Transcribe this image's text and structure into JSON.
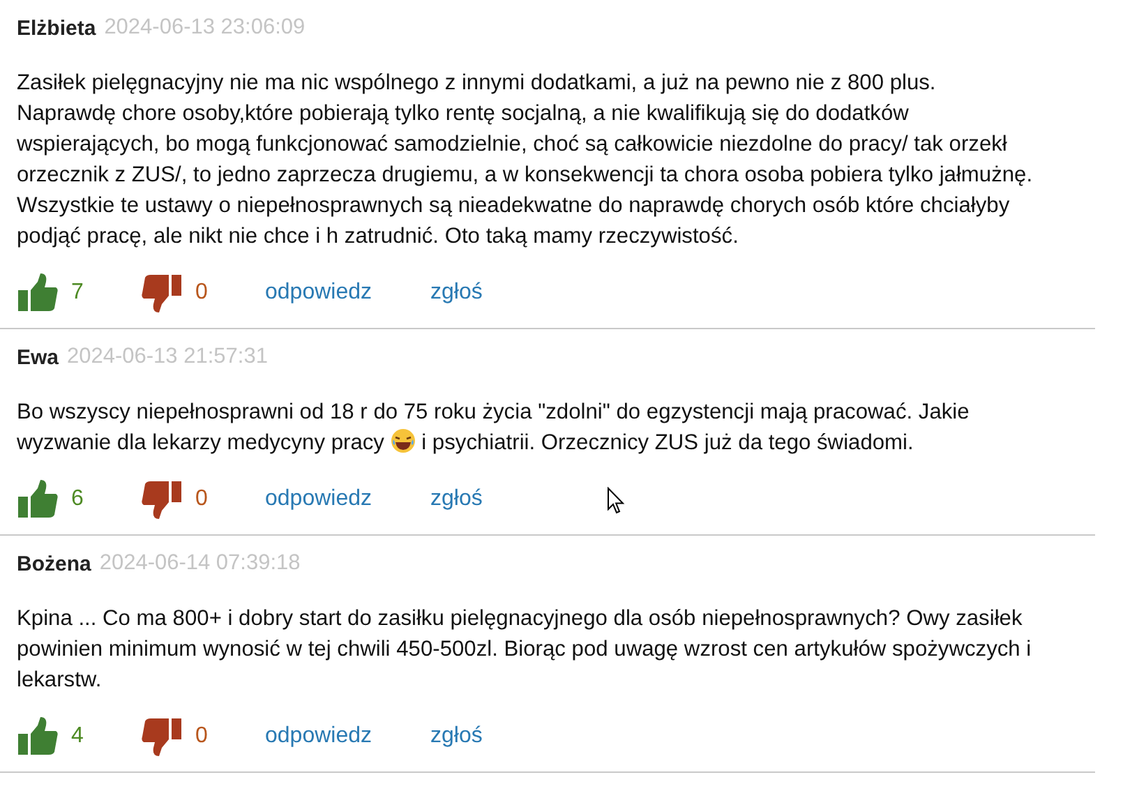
{
  "comments": [
    {
      "author": "Elżbieta",
      "date": "2024-06-13 23:06:09",
      "body": [
        {
          "kind": "text",
          "text": "Zasiłek pielęgnacyjny nie ma nic wspólnego z innymi dodatkami, a już na pewno nie z 800 plus.\nNaprawdę chore osoby,które pobierają tylko rentę socjalną, a nie kwalifikują się do dodatków\nwspierających, bo mogą funkcjonować samodzielnie, choć są całkowicie niezdolne do pracy/ tak orzekł\norzecznik z ZUS/, to jedno zaprzecza drugiemu, a w konsekwencji ta chora osoba pobiera tylko jałmużnę.\nWszystkie te ustawy o niepełnosprawnych są nieadekwatne do naprawdę chorych osób które chciałyby\npodjąć pracę, ale nikt nie chce i h zatrudnić. Oto taką mamy rzeczywistość."
        }
      ],
      "likes": "7",
      "dislikes": "0",
      "reply": "odpowiedz",
      "report": "zgłoś"
    },
    {
      "author": "Ewa",
      "date": "2024-06-13 21:57:31",
      "body": [
        {
          "kind": "text",
          "text": "Bo wszyscy niepełnosprawni od 18 r do 75 roku życia \"zdolni\" do egzystencji mają pracować. Jakie\nwyzwanie dla lekarzy medycyny pracy "
        },
        {
          "kind": "emoji"
        },
        {
          "kind": "text",
          "text": " i psychiatrii. Orzecznicy ZUS już da tego świadomi."
        }
      ],
      "likes": "6",
      "dislikes": "0",
      "reply": "odpowiedz",
      "report": "zgłoś"
    },
    {
      "author": "Bożena",
      "date": "2024-06-14 07:39:18",
      "body": [
        {
          "kind": "text",
          "text": "Kpina ... Co ma 800+ i dobry start do zasiłku pielęgnacyjnego dla osób niepełnosprawnych? Owy zasiłek\npowinien minimum wynosić w tej chwili 450-500zl. Biorąc pod uwagę wzrost cen artykułów spożywczych i\nlekarstw."
        }
      ],
      "likes": "4",
      "dislikes": "0",
      "reply": "odpowiedz",
      "report": "zgłoś"
    }
  ]
}
